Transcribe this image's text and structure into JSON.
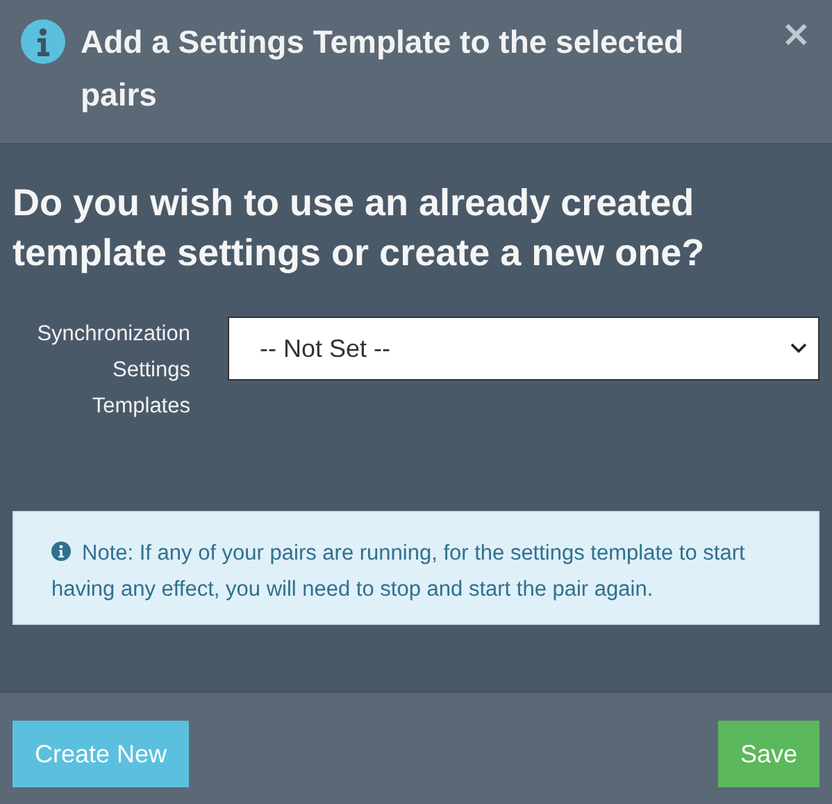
{
  "dialog": {
    "title": "Add a Settings Template to the selected pairs",
    "close": "×"
  },
  "question": "Do you wish to use an already created template settings or create a new one?",
  "field": {
    "label": "Synchronization Settings Templates",
    "value": "-- Not Set --"
  },
  "note": {
    "text": "Note: If any of your pairs are running, for the settings template to start having any effect, you will need to stop and start the pair again."
  },
  "buttons": [
    {
      "label": "Create New",
      "kind": "info"
    },
    {
      "label": "Save",
      "kind": "success"
    }
  ]
}
